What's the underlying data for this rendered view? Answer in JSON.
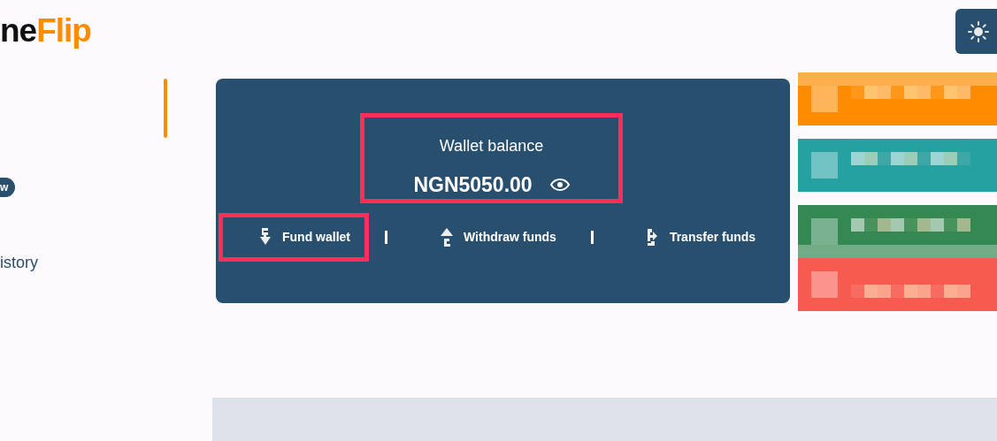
{
  "logo": {
    "dark_part": "ne",
    "accent_part": "Flip"
  },
  "sidebar": {
    "items": [
      {
        "kind": "indicator",
        "selected": true
      },
      {
        "kind": "badge",
        "label": "w"
      },
      {
        "kind": "link",
        "label": "istory"
      }
    ]
  },
  "wallet": {
    "title": "Wallet balance",
    "amount": "NGN5050.00",
    "highlighted": true,
    "actions": [
      {
        "kind": "fund",
        "label": "Fund wallet",
        "highlighted": true
      },
      {
        "kind": "withdraw",
        "label": "Withdraw funds",
        "highlighted": false
      },
      {
        "kind": "transfer",
        "label": "Transfer funds",
        "highlighted": false
      }
    ]
  },
  "side_cards": [
    {
      "color": "#ff8c00"
    },
    {
      "color": "#26a1a1"
    },
    {
      "color": "#348852"
    },
    {
      "color": "#f75b50"
    }
  ]
}
